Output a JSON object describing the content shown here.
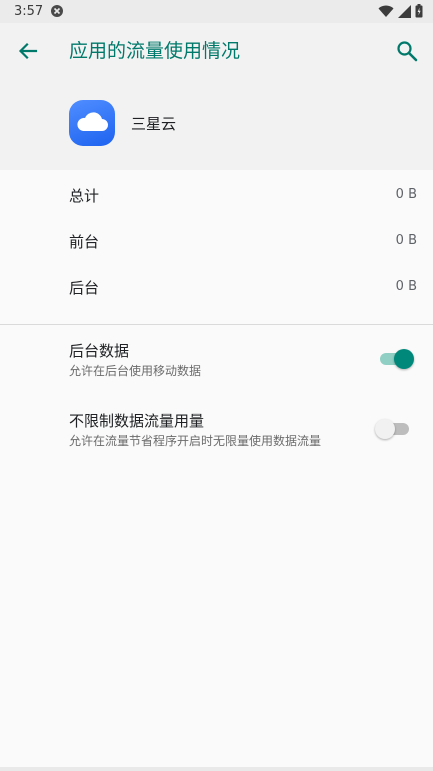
{
  "status_bar": {
    "time": "3:57"
  },
  "header": {
    "title": "应用的流量使用情况"
  },
  "app": {
    "name": "三星云"
  },
  "stats": [
    {
      "label": "总计",
      "value": "0 B"
    },
    {
      "label": "前台",
      "value": "0 B"
    },
    {
      "label": "后台",
      "value": "0 B"
    }
  ],
  "settings": {
    "background_data": {
      "title": "后台数据",
      "summary": "允许在后台使用移动数据",
      "enabled": true
    },
    "unrestricted_data": {
      "title": "不限制数据流量用量",
      "summary": "允许在流量节省程序开启时无限量使用数据流量",
      "enabled": false
    }
  },
  "colors": {
    "accent": "#00796b",
    "switch_on": "#00897b",
    "app_icon": "#2a6df4"
  }
}
